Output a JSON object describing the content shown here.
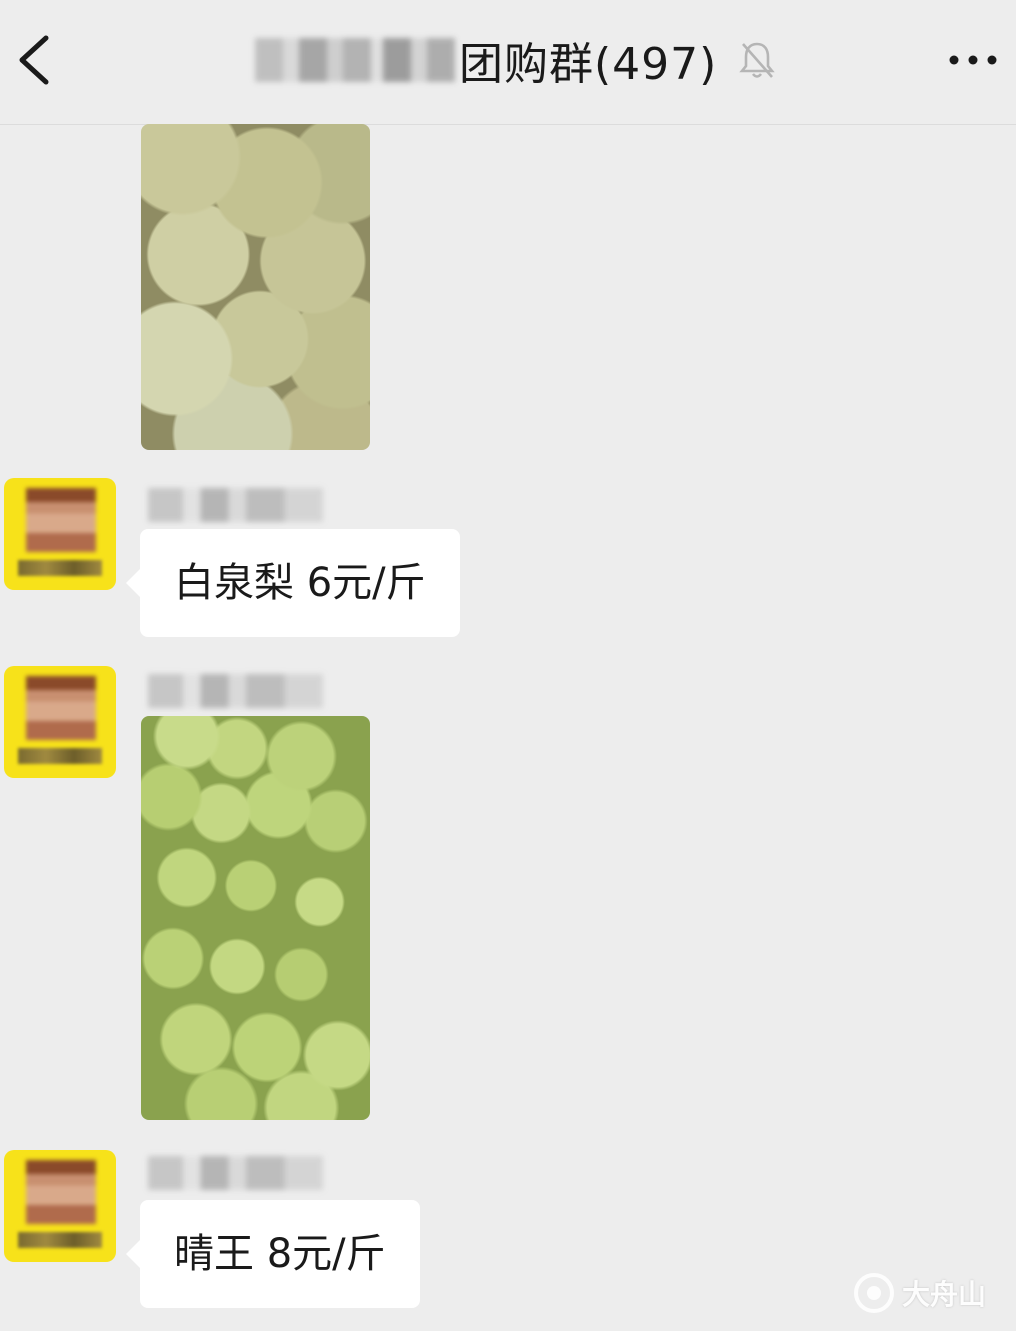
{
  "header": {
    "title": "团购群(497)"
  },
  "messages": [
    {
      "type": "image",
      "content": "pears"
    },
    {
      "type": "text",
      "text": "白泉梨 6元/斤"
    },
    {
      "type": "image",
      "content": "grapes"
    },
    {
      "type": "text",
      "text": "晴王 8元/斤"
    }
  ],
  "watermark": {
    "text": "大舟山"
  },
  "colors": {
    "background": "#ededed",
    "bubble": "#ffffff",
    "avatar": "#f7e21a"
  },
  "icons": [
    "back-chevron-icon",
    "mute-bell-icon",
    "more-dots-icon"
  ]
}
